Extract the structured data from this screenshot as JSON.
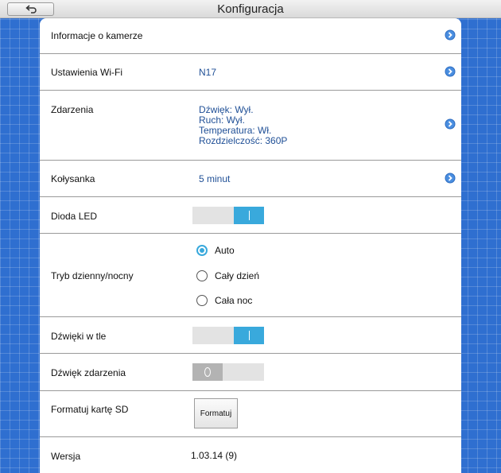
{
  "header": {
    "title": "Konfiguracja",
    "back_icon": "back-arrow-icon"
  },
  "rows": {
    "camera_info": {
      "label": "Informacje o kamerze"
    },
    "wifi": {
      "label": "Ustawienia Wi-Fi",
      "value": "N17"
    },
    "events": {
      "label": "Zdarzenia",
      "lines": [
        "Dźwięk: Wył.",
        "Ruch: Wył.",
        "Temperatura: Wł.",
        "Rozdzielczość: 360P"
      ]
    },
    "lullaby": {
      "label": "Kołysanka",
      "value": "5 minut"
    },
    "led": {
      "label": "Dioda LED",
      "on": true
    },
    "day_night": {
      "label": "Tryb dzienny/nocny",
      "options": [
        "Auto",
        "Cały dzień",
        "Cała noc"
      ],
      "selected": "Auto"
    },
    "background_sounds": {
      "label": "Dźwięki w tle",
      "on": true
    },
    "event_sound": {
      "label": "Dźwięk zdarzenia",
      "on": false
    },
    "format_sd": {
      "label": "Formatuj kartę SD",
      "button_label": "Formatuj"
    },
    "version": {
      "label": "Wersja",
      "value": "1.03.14 (9)"
    }
  },
  "colors": {
    "accent": "#39a9dc",
    "background": "#2f6fd0",
    "value_text": "#1f4f96"
  }
}
